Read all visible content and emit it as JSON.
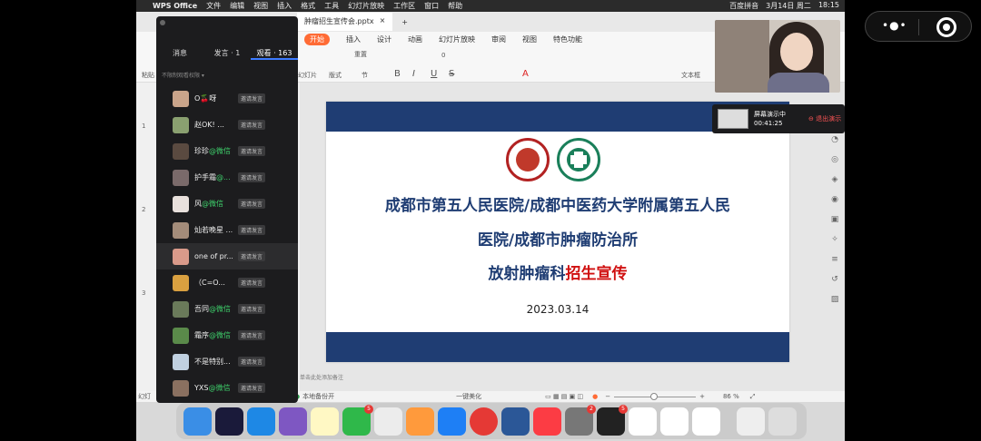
{
  "menubar": {
    "app": "WPS Office",
    "items": [
      "文件",
      "编辑",
      "视图",
      "插入",
      "格式",
      "工具",
      "幻灯片放映",
      "工作区",
      "窗口",
      "帮助"
    ],
    "right": [
      "百度拼音",
      "3月14日 周二",
      "18:15"
    ]
  },
  "doc_tab": "肿瘤招生宣传会.pptx",
  "ribbon_tabs": [
    "开始",
    "插入",
    "设计",
    "动画",
    "幻灯片放映",
    "审阅",
    "视图",
    "特色功能"
  ],
  "toolbar": {
    "paste": "粘贴",
    "reset": "重置",
    "slides": "幻灯片",
    "layout": "版式",
    "section": "节",
    "textbox": "文本框",
    "font_size": "0"
  },
  "share_panel": {
    "tabs": [
      "消息",
      "发言 · 1",
      "观看 · 163"
    ],
    "permission": "不限制观看权限",
    "invite_label": "邀请发言",
    "viewers": [
      {
        "name": "O🍒呀",
        "wx": ""
      },
      {
        "name": "赵OK! ...",
        "wx": ""
      },
      {
        "name": "珍珍",
        "wx": "@微信"
      },
      {
        "name": "护手霜",
        "wx": "@..."
      },
      {
        "name": "风",
        "wx": "@微信"
      },
      {
        "name": "灿若晚星 ...",
        "wx": ""
      },
      {
        "name": "one of pr...",
        "wx": ""
      },
      {
        "name": "（C=O...",
        "wx": ""
      },
      {
        "name": "吾同",
        "wx": "@微信"
      },
      {
        "name": "霜序",
        "wx": "@微信"
      },
      {
        "name": "不是特别...",
        "wx": ""
      },
      {
        "name": "YXS",
        "wx": "@微信"
      }
    ]
  },
  "screen_share": {
    "label": "屏幕演示中",
    "time": "00:41:25",
    "stop": "退出演示"
  },
  "slide": {
    "line1": "成都市第五人民医院/成都中医药大学附属第五人民",
    "line2": "医院/成都市肿瘤防治所",
    "line3_a": "放射肿瘤科",
    "line3_b": "招生宣传",
    "date": "2023.03.14"
  },
  "thumb_numbers": [
    "1",
    "2",
    "3"
  ],
  "notes_hint": "单击此处添加备注",
  "status": {
    "left": "幻灯",
    "backup": "本地备份开",
    "beautify": "一键美化",
    "zoom": "86 %"
  },
  "dock_badges": {
    "facetime": "5",
    "facetime2": "2",
    "qq": "5"
  }
}
